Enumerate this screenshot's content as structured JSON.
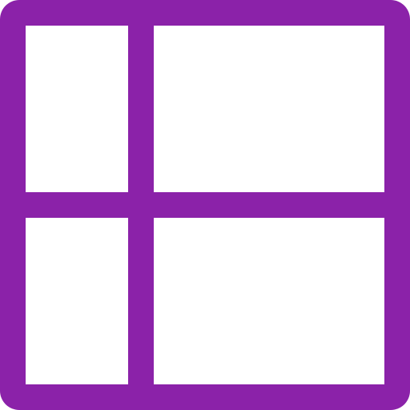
{
  "icon": {
    "name": "grid-layout-icon",
    "color": "#8B22A9",
    "background": "#FFFFFF"
  }
}
